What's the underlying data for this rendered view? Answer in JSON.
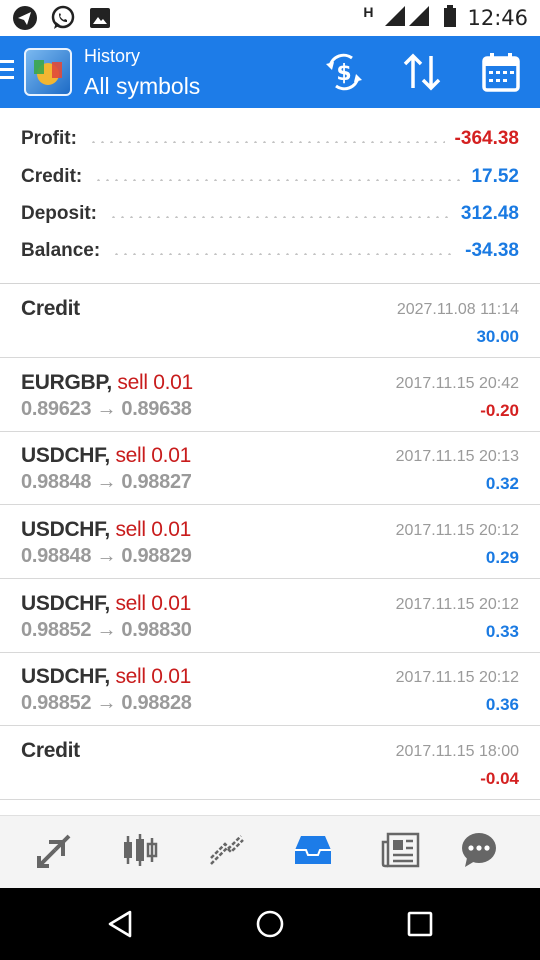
{
  "status_bar": {
    "time": "12:46",
    "network_letter": "H",
    "icons": [
      "telegram-icon",
      "whatsapp-icon",
      "gallery-icon",
      "signal-icon",
      "battery-icon"
    ]
  },
  "header": {
    "title": "History",
    "subtitle": "All symbols",
    "icons": [
      "currency-exchange-icon",
      "sort-icon",
      "calendar-icon"
    ]
  },
  "summary": [
    {
      "label": "Profit:",
      "value": "-364.38",
      "color": "#d42020"
    },
    {
      "label": "Credit:",
      "value": "17.52",
      "color": "#1a7ae2"
    },
    {
      "label": "Deposit:",
      "value": "312.48",
      "color": "#1a7ae2"
    },
    {
      "label": "Balance:",
      "value": "-34.38",
      "color": "#1a7ae2"
    }
  ],
  "items": [
    {
      "symbol": "Credit",
      "side": "",
      "prices": "",
      "date": "2027.11.08 11:14",
      "profit": "30.00",
      "profit_color": "#1a7ae2"
    },
    {
      "symbol": "EURGBP,",
      "side": "sell 0.01",
      "prices": "0.89623 → 0.89638",
      "date": "2017.11.15 20:42",
      "profit": "-0.20",
      "profit_color": "#d42020"
    },
    {
      "symbol": "USDCHF,",
      "side": "sell 0.01",
      "prices": "0.98848 → 0.98827",
      "date": "2017.11.15 20:13",
      "profit": "0.32",
      "profit_color": "#1a7ae2"
    },
    {
      "symbol": "USDCHF,",
      "side": "sell 0.01",
      "prices": "0.98848 → 0.98829",
      "date": "2017.11.15 20:12",
      "profit": "0.29",
      "profit_color": "#1a7ae2"
    },
    {
      "symbol": "USDCHF,",
      "side": "sell 0.01",
      "prices": "0.98852 → 0.98830",
      "date": "2017.11.15 20:12",
      "profit": "0.33",
      "profit_color": "#1a7ae2"
    },
    {
      "symbol": "USDCHF,",
      "side": "sell 0.01",
      "prices": "0.98852 → 0.98828",
      "date": "2017.11.15 20:12",
      "profit": "0.36",
      "profit_color": "#1a7ae2"
    },
    {
      "symbol": "Credit",
      "side": "",
      "prices": "",
      "date": "2017.11.15 18:00",
      "profit": "-0.04",
      "profit_color": "#d42020"
    }
  ],
  "bottom_tabs": [
    {
      "icon": "quotes-icon",
      "active": false
    },
    {
      "icon": "chart-icon",
      "active": false
    },
    {
      "icon": "trade-icon",
      "active": false
    },
    {
      "icon": "history-icon",
      "active": true
    },
    {
      "icon": "news-icon",
      "active": false
    },
    {
      "icon": "chat-icon",
      "active": false
    }
  ],
  "nav": [
    "back-icon",
    "home-icon",
    "recents-icon"
  ],
  "colors": {
    "accent": "#1d7ce8",
    "negative": "#d42020",
    "positive": "#1a7ae2",
    "active_tab": "#1d7ce8",
    "inactive_tab": "#666666"
  }
}
